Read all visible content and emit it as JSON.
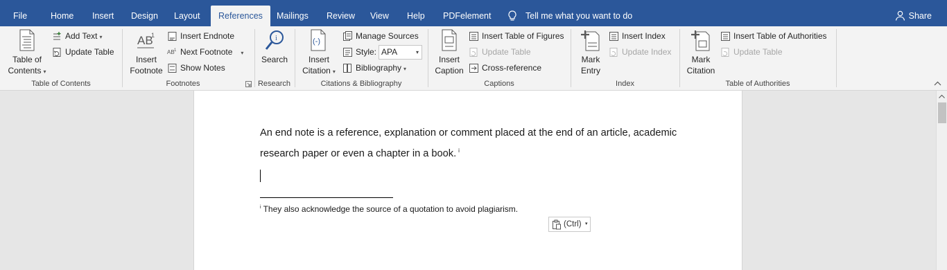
{
  "tabs": [
    {
      "label": "File"
    },
    {
      "label": "Home"
    },
    {
      "label": "Insert"
    },
    {
      "label": "Design"
    },
    {
      "label": "Layout"
    },
    {
      "label": "References"
    },
    {
      "label": "Mailings"
    },
    {
      "label": "Review"
    },
    {
      "label": "View"
    },
    {
      "label": "Help"
    },
    {
      "label": "PDFelement"
    }
  ],
  "active_tab": "References",
  "tell_me": "Tell me what you want to do",
  "share": "Share",
  "ribbon": {
    "toc": {
      "table_of_contents_line1": "Table of",
      "table_of_contents_line2": "Contents",
      "add_text": "Add Text",
      "update_table": "Update Table",
      "group": "Table of Contents"
    },
    "footnotes": {
      "insert_footnote_line1": "Insert",
      "insert_footnote_line2": "Footnote",
      "insert_endnote": "Insert Endnote",
      "next_footnote": "Next Footnote",
      "show_notes": "Show Notes",
      "group": "Footnotes",
      "icon_text": "AB"
    },
    "research": {
      "search": "Search",
      "group": "Research"
    },
    "citations": {
      "insert_citation_line1": "Insert",
      "insert_citation_line2": "Citation",
      "manage_sources": "Manage Sources",
      "style_label": "Style:",
      "style_value": "APA",
      "bibliography": "Bibliography",
      "group": "Citations & Bibliography"
    },
    "captions": {
      "insert_caption_line1": "Insert",
      "insert_caption_line2": "Caption",
      "insert_table_of_figures": "Insert Table of Figures",
      "update_table": "Update Table",
      "cross_reference": "Cross-reference",
      "group": "Captions"
    },
    "index": {
      "mark_entry_line1": "Mark",
      "mark_entry_line2": "Entry",
      "insert_index": "Insert Index",
      "update_index": "Update Index",
      "group": "Index"
    },
    "authorities": {
      "mark_citation_line1": "Mark",
      "mark_citation_line2": "Citation",
      "insert_table_of_authorities": "Insert Table of Authorities",
      "update_table": "Update Table",
      "group": "Table of Authorities"
    }
  },
  "document": {
    "paragraph": "An end note is a reference, explanation or comment placed at the end of an article, academic research paper or even a chapter in a book.",
    "note_mark": "i",
    "footnote_mark": "i",
    "footnote_text": "They also acknowledge the source of a quotation to avoid plagiarism.",
    "paste_options": "(Ctrl)"
  },
  "colors": {
    "tabbar": "#2b579a",
    "ribbon": "#f3f3f3",
    "page": "#ffffff",
    "canvas": "#e6e6e6"
  }
}
